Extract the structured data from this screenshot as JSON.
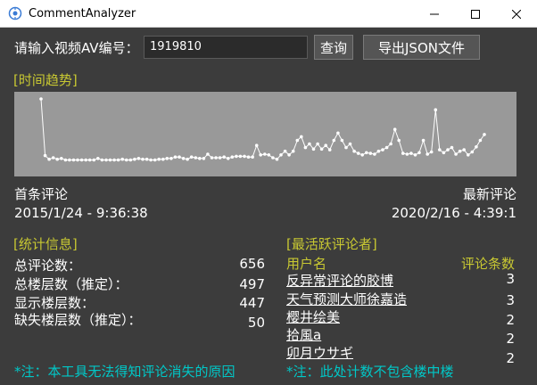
{
  "window": {
    "title": "CommentAnalyzer"
  },
  "query": {
    "label": "请输入视频AV编号：",
    "av_value": "1919810",
    "query_button": "查询",
    "export_button": "导出JSON文件"
  },
  "trend": {
    "title": "[时间趋势]",
    "chart_data": {
      "type": "line",
      "values": [
        9.2,
        1.4,
        0.9,
        1.1,
        0.9,
        1.0,
        0.8,
        0.8,
        0.8,
        0.8,
        0.8,
        0.8,
        0.8,
        0.8,
        1.0,
        0.8,
        0.8,
        0.8,
        0.8,
        0.8,
        0.9,
        0.8,
        0.8,
        0.9,
        1.0,
        0.9,
        0.9,
        0.8,
        0.8,
        0.9,
        0.9,
        1.0,
        1.0,
        1.2,
        1.2,
        1.0,
        0.9,
        1.2,
        1.1,
        1.0,
        1.0,
        1.6,
        1.1,
        1.1,
        1.1,
        1.2,
        1.0,
        1.2,
        1.3,
        1.3,
        1.3,
        1.2,
        1.2,
        2.8,
        1.5,
        1.6,
        1.5,
        1.1,
        0.9,
        1.5,
        2.0,
        1.5,
        2.0,
        3.5,
        4.0,
        2.5,
        3.0,
        2.3,
        3.0,
        2.3,
        2.8,
        2.2,
        3.5,
        4.5,
        3.5,
        2.5,
        3.0,
        2.0,
        1.7,
        1.5,
        1.8,
        1.7,
        1.6,
        2.0,
        2.2,
        2.5,
        3.0,
        5.0,
        3.5,
        1.7,
        1.6,
        1.7,
        1.5,
        1.8,
        3.5,
        1.6,
        1.9,
        7.7,
        2.2,
        1.8,
        2.2,
        2.5,
        1.6,
        2.0,
        2.2,
        1.5,
        1.9,
        2.6,
        3.5,
        4.3
      ]
    }
  },
  "range": {
    "first_label": "首条评论",
    "first_time": "2015/1/24 - 9:36:38",
    "last_label": "最新评论",
    "last_time": "2020/2/16 - 4:39:1"
  },
  "stats": {
    "title": "[统计信息]",
    "items": [
      {
        "label": "总评论数：",
        "value": "656"
      },
      {
        "label": "总楼层数（推定）：",
        "value": "497"
      },
      {
        "label": "显示楼层数：",
        "value": "447"
      },
      {
        "label": "缺失楼层数（推定）：",
        "value": "50"
      }
    ],
    "note": "*注：本工具无法得知评论消失的原因"
  },
  "active": {
    "title": "[最活跃评论者]",
    "col_user": "用户名",
    "col_count": "评论条数",
    "users": [
      {
        "name": "反异常评论的胶博",
        "count": "3"
      },
      {
        "name": "天气预测大师徐嘉诰",
        "count": "3"
      },
      {
        "name": "樱井绘美",
        "count": "2"
      },
      {
        "name": "拾風a",
        "count": "2"
      },
      {
        "name": "卯月ウサギ",
        "count": "2"
      }
    ],
    "note": "*注：此处计数不包含楼中楼"
  },
  "colors": {
    "background": "#3c3c3c",
    "accent_yellow": "#c8c832",
    "note_cyan": "#00c8c8",
    "chart_bg": "#999999",
    "line": "#ffffff"
  }
}
